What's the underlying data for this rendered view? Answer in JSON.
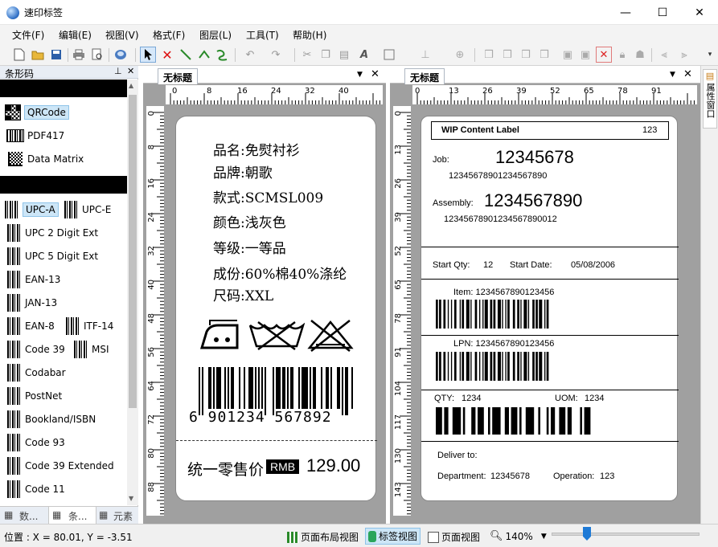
{
  "window": {
    "title": "速印标签",
    "minimize": "—",
    "maximize": "☐",
    "close": "✕"
  },
  "menu": [
    "文件(F)",
    "编辑(E)",
    "视图(V)",
    "格式(F)",
    "图层(L)",
    "工具(T)",
    "帮助(H)"
  ],
  "left_panel": {
    "title": "条形码",
    "pin": "⊥",
    "close": "✕",
    "items": [
      {
        "label": "QRCode",
        "icon": "qrcode-icon"
      },
      {
        "label": "PDF417",
        "icon": "pdf417-icon"
      },
      {
        "label": "Data Matrix",
        "icon": "datamatrix-icon"
      }
    ],
    "linear": [
      [
        "UPC-A",
        "UPC-E"
      ],
      [
        "UPC 2 Digit Ext"
      ],
      [
        "UPC 5 Digit Ext"
      ],
      [
        "EAN-13"
      ],
      [
        "JAN-13"
      ],
      [
        "EAN-8",
        "ITF-14"
      ],
      [
        "Code 39",
        "MSI"
      ],
      [
        "Codabar"
      ],
      [
        "PostNet"
      ],
      [
        "Bookland/ISBN"
      ],
      [
        "Code 93"
      ],
      [
        "Code 39 Extended"
      ],
      [
        "Code 11"
      ]
    ],
    "tabs": [
      "数...",
      "条...",
      "元素"
    ]
  },
  "doc1": {
    "tab": "无标题",
    "ruler_top": [
      "0",
      "8",
      "16",
      "24",
      "32",
      "40"
    ],
    "ruler_left": [
      "0",
      "8",
      "16",
      "24",
      "32",
      "40",
      "48",
      "56",
      "64",
      "72",
      "80",
      "88"
    ],
    "lines": [
      "品名:免熨衬衫",
      "品牌:朝歌",
      "款式:SCMSL009",
      "颜色:浅灰色",
      "等级:一等品",
      "成份:60%棉40%涤纶",
      "尺码:XXL"
    ],
    "barcode_text": "6 901234 567892",
    "price_label": "统一零售价",
    "currency": "RMB",
    "price": "129.00"
  },
  "doc2": {
    "tab": "无标题",
    "ruler_top": [
      "0",
      "13",
      "26",
      "39",
      "52",
      "65",
      "78",
      "91"
    ],
    "ruler_left": [
      "0",
      "13",
      "26",
      "39",
      "52",
      "65",
      "78",
      "91",
      "104",
      "117",
      "130",
      "143"
    ],
    "header_title": "WIP Content Label",
    "header_num": "123",
    "job_label": "Job:",
    "job_value": "12345678",
    "job_sub": "12345678901234567890",
    "assembly_label": "Assembly:",
    "assembly_value": "1234567890",
    "assembly_sub": "12345678901234567890012",
    "start_qty_label": "Start Qty:",
    "start_qty": "12",
    "start_date_label": "Start Date:",
    "start_date": "05/08/2006",
    "item": "Item:  1234567890123456",
    "lpn": "LPN:  1234567890123456",
    "qty_label": "QTY:",
    "qty": "1234",
    "uom_label": "UOM:",
    "uom": "1234",
    "deliver": "Deliver to:",
    "department_label": "Department:",
    "department": "12345678",
    "operation_label": "Operation:",
    "operation": "123"
  },
  "right_dock": "属性窗口",
  "status": {
    "position": "位置 : X = 80.01, Y = -3.51",
    "page_layout": "页面布局视图",
    "label_view": "标签视图",
    "page_view": "页面视图",
    "zoom": "140%"
  }
}
